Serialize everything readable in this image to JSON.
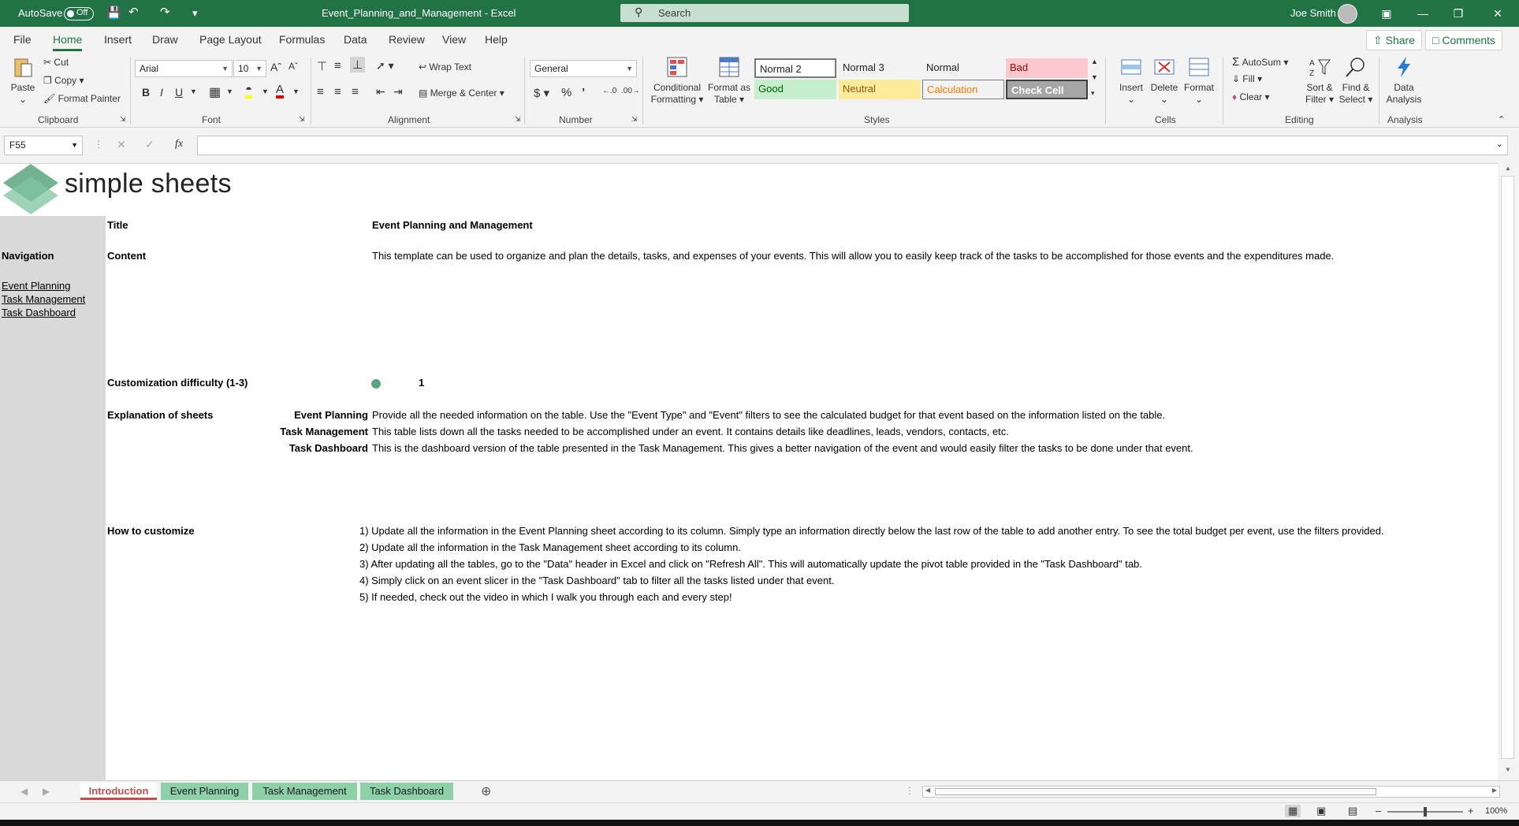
{
  "titlebar": {
    "autosave_label": "AutoSave",
    "autosave_state": "Off",
    "filename": "Event_Planning_and_Management  -  Excel",
    "search_placeholder": "Search",
    "user_name": "Joe Smith"
  },
  "menu": {
    "tabs": [
      "File",
      "Home",
      "Insert",
      "Draw",
      "Page Layout",
      "Formulas",
      "Data",
      "Review",
      "View",
      "Help"
    ],
    "active": "Home",
    "share_label": "Share",
    "comments_label": "Comments"
  },
  "ribbon": {
    "clipboard": {
      "paste": "Paste",
      "cut": "Cut",
      "copy": "Copy",
      "format_painter": "Format Painter",
      "label": "Clipboard"
    },
    "font": {
      "name": "Arial",
      "size": "10",
      "label": "Font",
      "bold": "B",
      "italic": "I",
      "underline": "U"
    },
    "alignment": {
      "wrap_text": "Wrap Text",
      "merge_center": "Merge & Center",
      "label": "Alignment"
    },
    "number": {
      "format": "General",
      "label": "Number"
    },
    "styles": {
      "conditional_formatting": "Conditional Formatting",
      "format_as_table": "Format as Table",
      "cells": [
        "Normal 2",
        "Normal 3",
        "Normal",
        "Bad",
        "Good",
        "Neutral",
        "Calculation",
        "Check Cell"
      ],
      "label": "Styles"
    },
    "cells": {
      "insert": "Insert",
      "delete": "Delete",
      "format": "Format",
      "label": "Cells"
    },
    "editing": {
      "autosum": "AutoSum",
      "fill": "Fill",
      "clear": "Clear",
      "sort_filter": "Sort & Filter",
      "find_select": "Find & Select",
      "label": "Editing"
    },
    "analysis": {
      "data_analysis": "Data Analysis",
      "label": "Analysis"
    }
  },
  "formula_bar": {
    "name_box": "F55",
    "fx": "fx",
    "value": ""
  },
  "sheet": {
    "logo_text": "simple sheets",
    "nav_heading": "Navigation",
    "nav_links": [
      "Event Planning",
      "Task Management",
      "Task Dashboard"
    ],
    "title_label": "Title",
    "title_value": "Event Planning and Management",
    "content_label": "Content",
    "content_value": "This template can be used to organize and plan the details, tasks, and expenses of your events. This will allow you to easily keep track of the tasks to be accomplished for those events and the expenditures made.",
    "difficulty_label": "Customization difficulty (1-3)",
    "difficulty_value": "1",
    "explanation_label": "Explanation of sheets",
    "explanations": [
      {
        "sheet": "Event Planning",
        "text": "Provide all the needed information on the table. Use the \"Event Type\" and \"Event\" filters to see the calculated budget for that event based on the information listed on the table."
      },
      {
        "sheet": "Task Management",
        "text": "This table lists down all the tasks needed to be accomplished under an event. It contains details like deadlines, leads, vendors, contacts, etc."
      },
      {
        "sheet": "Task Dashboard",
        "text": "This is the dashboard version of the table presented in the Task Management. This gives a better navigation of the event and would easily filter the tasks to be done under that event."
      }
    ],
    "customize_label": "How to customize",
    "customize_steps": [
      "1) Update all the information in the Event Planning sheet according to its column. Simply type an information directly below the last row of the table to add another entry. To see the total budget per event, use the filters provided.",
      "2) Update all the information in the Task Management sheet according to its column.",
      "3) After updating all the tables, go to the \"Data\" header in Excel and click on \"Refresh All\". This will automatically update the pivot table provided in the \"Task Dashboard\" tab.",
      "4) Simply click on an event slicer in the \"Task Dashboard\" tab to filter all the tasks listed under that event.",
      "5) If needed, check out the video in which I walk you through each and every step!"
    ]
  },
  "sheet_tabs": [
    "Introduction",
    "Event Planning",
    "Task Management",
    "Task Dashboard"
  ],
  "active_sheet": "Introduction",
  "status": {
    "zoom": "100%"
  },
  "colors": {
    "excel_green": "#217346",
    "sheet_tab_green": "#8ed1a9",
    "active_tab_red": "#c0504d",
    "nav_gray": "#d9d9d9",
    "dot_green": "#5aa57f"
  }
}
